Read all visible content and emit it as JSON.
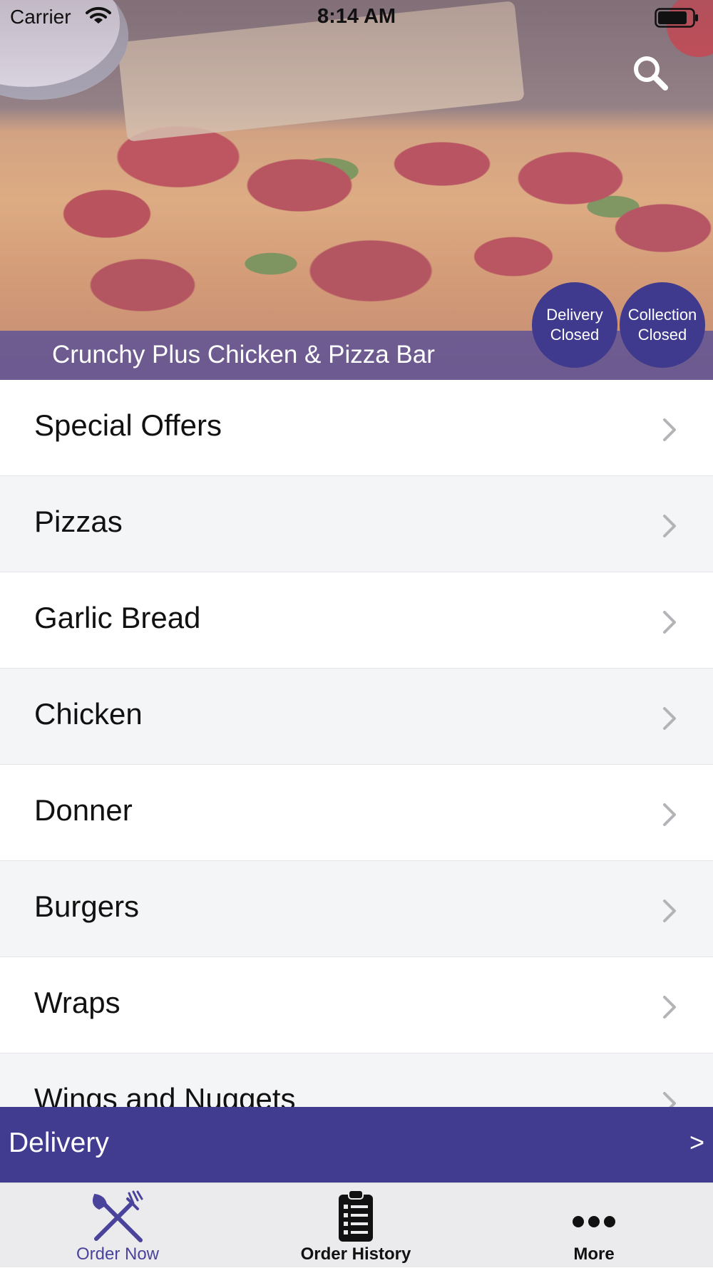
{
  "status_bar": {
    "carrier": "Carrier",
    "time": "8:14 AM",
    "wifi_icon": "wifi-icon",
    "battery_icon": "battery-icon"
  },
  "header": {
    "restaurant_name": "Crunchy Plus Chicken & Pizza Bar",
    "search_icon": "search-icon",
    "delivery_status": {
      "line1": "Delivery",
      "line2": "Closed"
    },
    "collection_status": {
      "line1": "Collection",
      "line2": "Closed"
    }
  },
  "categories": [
    {
      "label": "Special Offers"
    },
    {
      "label": "Pizzas"
    },
    {
      "label": "Garlic Bread"
    },
    {
      "label": "Chicken"
    },
    {
      "label": "Donner"
    },
    {
      "label": "Burgers"
    },
    {
      "label": "Wraps"
    },
    {
      "label": "Wings and Nuggets"
    }
  ],
  "delivery_bar": {
    "label": "Delivery",
    "arrow": ">"
  },
  "tab_bar": {
    "tabs": [
      {
        "label": "Order Now",
        "icon": "fork-knife-icon",
        "active": true
      },
      {
        "label": "Order History",
        "icon": "clipboard-list-icon",
        "active": false
      },
      {
        "label": "More",
        "icon": "more-dots-icon",
        "active": false
      }
    ]
  },
  "colors": {
    "brand": "#413c90",
    "active_tab": "#4a439c",
    "row_alt": "#f4f5f7"
  }
}
